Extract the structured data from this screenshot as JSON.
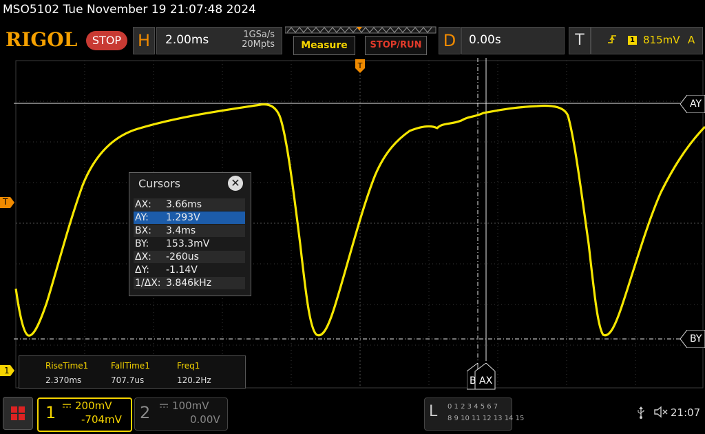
{
  "title_bar": "MSO5102  Tue November 19 21:07:48 2024",
  "logo": "RIGOL",
  "run_state": "STOP",
  "horizontal": {
    "letter": "H",
    "timebase": "2.00ms",
    "sample_rate": "1GSa/s",
    "memory": "20Mpts"
  },
  "buttons": {
    "measure": "Measure",
    "stop_run": "STOP/RUN"
  },
  "delay": {
    "letter": "D",
    "value": "0.00s"
  },
  "trigger": {
    "letter": "T",
    "edge_icon": "rising-edge-icon",
    "source": "1",
    "level": "815mV",
    "mode": "A"
  },
  "markers": {
    "trig_left": "T",
    "ch1_left": "1",
    "ay": "AY",
    "by": "BY",
    "bx": "B",
    "ax": "AX"
  },
  "cursors": {
    "title": "Cursors",
    "close": "✕",
    "rows": [
      {
        "key": "AX:",
        "value": "3.66ms"
      },
      {
        "key": "AY:",
        "value": "1.293V"
      },
      {
        "key": "BX:",
        "value": "3.4ms"
      },
      {
        "key": "BY:",
        "value": "153.3mV"
      },
      {
        "key": "ΔX:",
        "value": "-260us"
      },
      {
        "key": "ΔY:",
        "value": "-1.14V"
      },
      {
        "key": "1/ΔX:",
        "value": "3.846kHz"
      }
    ]
  },
  "measurements": {
    "headers": [
      "RiseTime1",
      "FallTime1",
      "Freq1"
    ],
    "values": [
      "2.370ms",
      "707.7us",
      "120.2Hz"
    ]
  },
  "ch1": {
    "num": "1",
    "scale": "200mV",
    "offset": "-704mV",
    "color": "#f5d400"
  },
  "ch2": {
    "num": "2",
    "scale": "100mV",
    "offset": "0.00V"
  },
  "logic": {
    "letter": "L",
    "row1": "0 1 2 3   4 5 6 7",
    "row2": "8 9 10 11  12 13 14 15"
  },
  "status": {
    "clock": "21:07",
    "usb_icon": "usb-icon",
    "volume_icon": "speaker-mute-icon"
  }
}
